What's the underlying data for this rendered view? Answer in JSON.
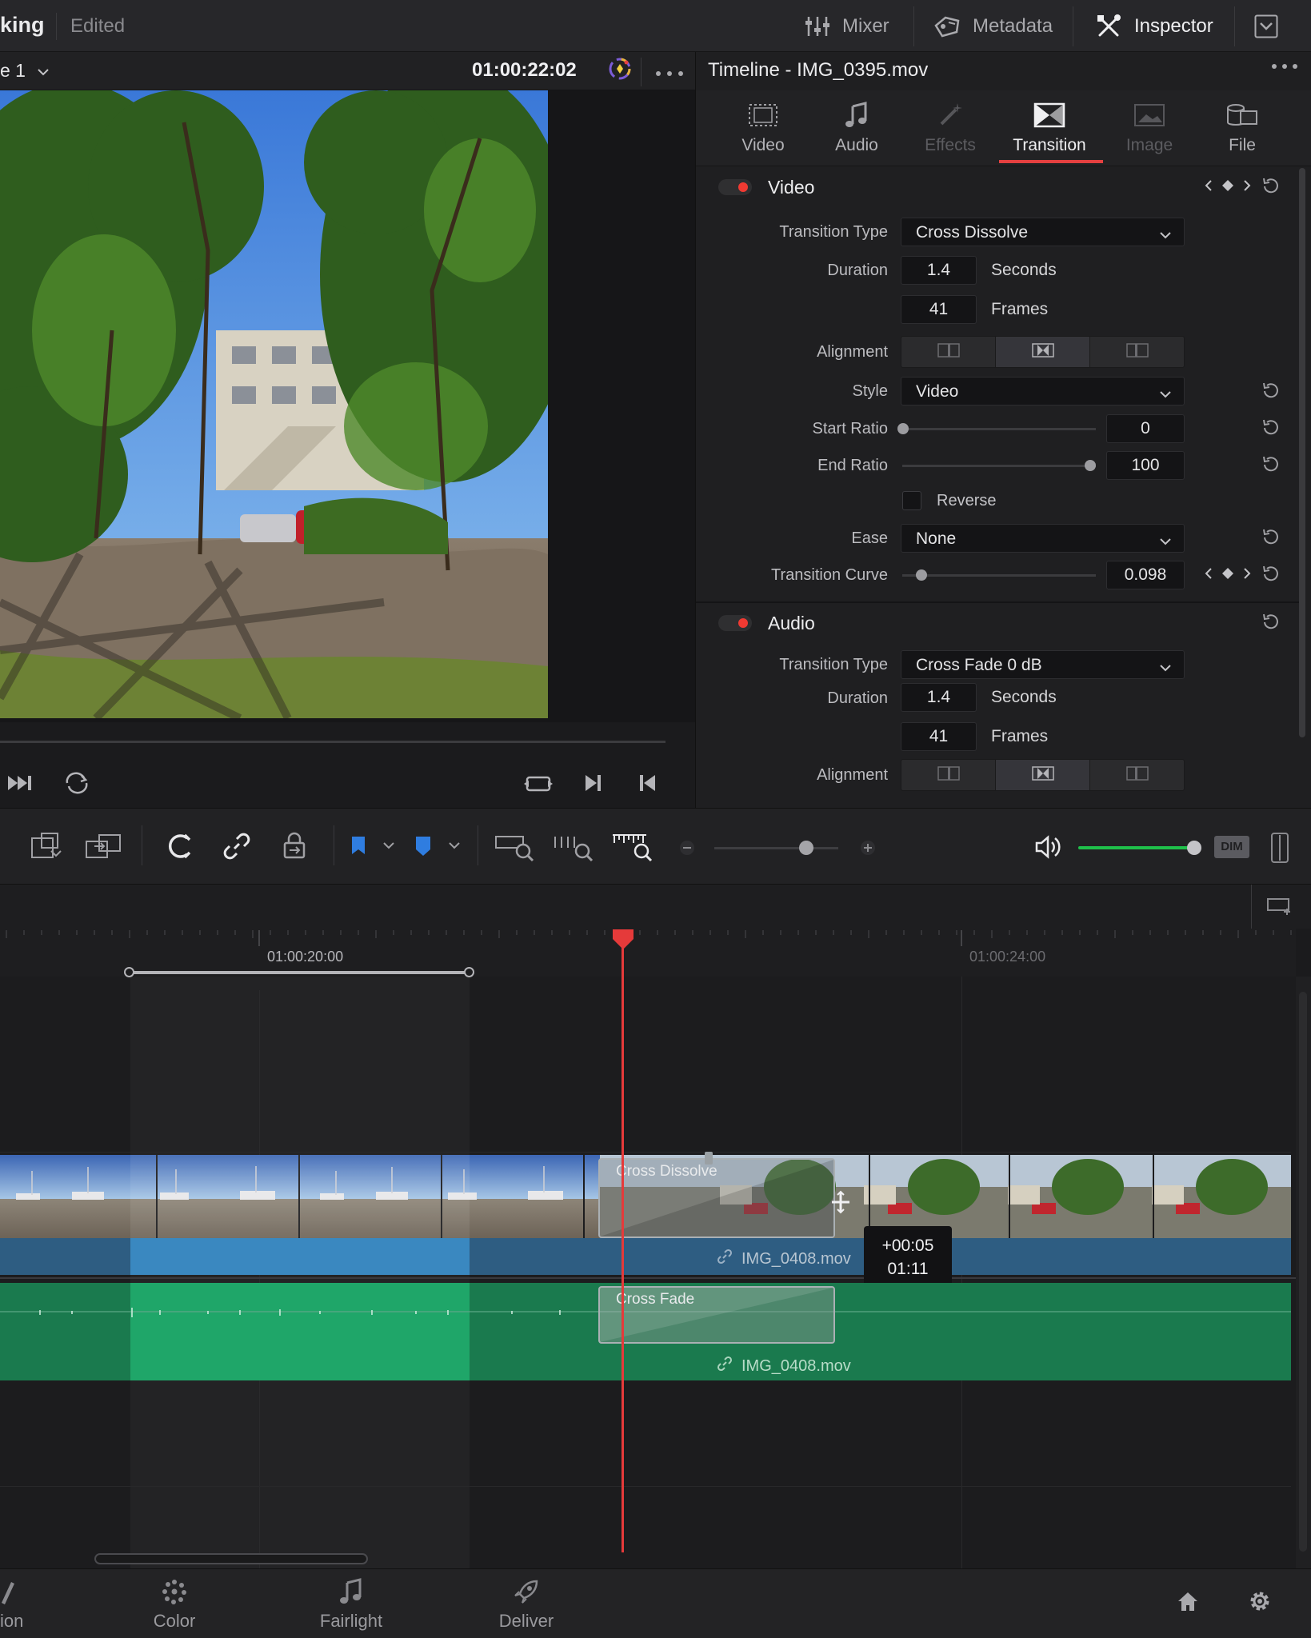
{
  "header": {
    "project_name": "king",
    "status": "Edited",
    "mixer_label": "Mixer",
    "metadata_label": "Metadata",
    "inspector_label": "Inspector"
  },
  "viewer": {
    "timeline_select": "e 1",
    "timecode": "01:00:22:02"
  },
  "inspector": {
    "title": "Timeline - IMG_0395.mov",
    "tabs": [
      {
        "label": "Video",
        "icon": "film-icon"
      },
      {
        "label": "Audio",
        "icon": "music-note-icon"
      },
      {
        "label": "Effects",
        "icon": "magic-wand-icon"
      },
      {
        "label": "Transition",
        "icon": "transition-icon"
      },
      {
        "label": "Image",
        "icon": "image-icon"
      },
      {
        "label": "File",
        "icon": "file-icon"
      }
    ],
    "active_tab": "Transition",
    "video": {
      "title": "Video",
      "transition_type_label": "Transition Type",
      "transition_type": "Cross Dissolve",
      "duration_label": "Duration",
      "duration_seconds": "1.4",
      "seconds_unit": "Seconds",
      "duration_frames": "41",
      "frames_unit": "Frames",
      "alignment_label": "Alignment",
      "style_label": "Style",
      "style": "Video",
      "start_ratio_label": "Start Ratio",
      "start_ratio": "0",
      "start_ratio_level": 0,
      "end_ratio_label": "End Ratio",
      "end_ratio": "100",
      "end_ratio_level": 1,
      "reverse_label": "Reverse",
      "reverse_checked": false,
      "ease_label": "Ease",
      "ease": "None",
      "curve_label": "Transition Curve",
      "curve": "0.098",
      "curve_level": 0.098
    },
    "audio": {
      "title": "Audio",
      "transition_type_label": "Transition Type",
      "transition_type": "Cross Fade 0 dB",
      "duration_label": "Duration",
      "duration_seconds": "1.4",
      "seconds_unit": "Seconds",
      "duration_frames": "41",
      "frames_unit": "Frames",
      "alignment_label": "Alignment"
    }
  },
  "toolbar": {
    "dim_label": "DIM",
    "volume_level": 1.0
  },
  "timeline": {
    "timecode_labels": [
      "01:00:20:00",
      "01:00:24:00"
    ],
    "video_transition_label": "Cross Dissolve",
    "audio_transition_label": "Cross Fade",
    "video_clip_name": "IMG_0408.mov",
    "audio_clip_name": "IMG_0408.mov",
    "tooltip_offset": "+00:05",
    "tooltip_duration": "01:11"
  },
  "pages": [
    {
      "label": "ion",
      "icon": "pen-icon"
    },
    {
      "label": "Color",
      "icon": "color-wheel-icon"
    },
    {
      "label": "Fairlight",
      "icon": "music-note-icon"
    },
    {
      "label": "Deliver",
      "icon": "rocket-icon"
    }
  ],
  "colors": {
    "accent_red": "#e44040",
    "video_clip_blue": "#2e5d82",
    "audio_clip_green": "#1a7a4e",
    "volume_green": "#1fc04a",
    "playhead_red": "#e53a3a"
  }
}
